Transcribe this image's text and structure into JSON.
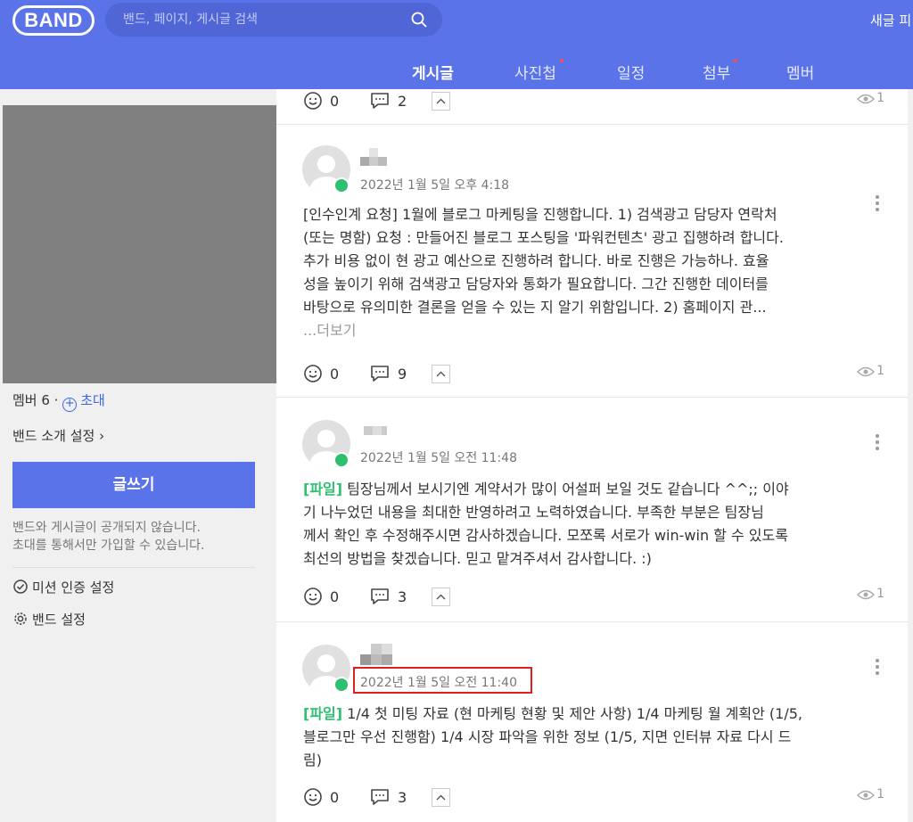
{
  "header": {
    "logo": "BAND",
    "search_placeholder": "밴드, 페이지, 게시글 검색",
    "right_text": "새글 피"
  },
  "tabs": [
    {
      "label": "게시글",
      "active": true,
      "dot": false
    },
    {
      "label": "사진첩",
      "active": false,
      "dot": true
    },
    {
      "label": "일정",
      "active": false,
      "dot": false
    },
    {
      "label": "첨부",
      "active": false,
      "dot": true
    },
    {
      "label": "멤버",
      "active": false,
      "dot": false
    }
  ],
  "sidebar": {
    "member_count": "멤버 6 ·",
    "invite": "초대",
    "band_intro": "밴드 소개 설정",
    "write_button": "글쓰기",
    "notice_line1": "밴드와 게시글이 공개되지 않습니다.",
    "notice_line2": "초대를 통해서만 가입할 수 있습니다.",
    "mission": "미션 인증 설정",
    "band_settings": "밴드 설정"
  },
  "posts": [
    {
      "comments": "0",
      "emotions": "2",
      "views": "1"
    },
    {
      "date": "2022년 1월 5일 오후 4:18",
      "line1": "[인수인계 요청] 1월에 블로그 마케팅을 진행합니다. 1) 검색광고 담당자 연락처",
      "line2": "(또는 명함) 요청 : 만들어진 블로그 포스팅을 '파워컨텐츠' 광고 집행하려 합니다.",
      "line3": "추가 비용 없이 현 광고 예산으로 진행하려 합니다. 바로 진행은 가능하나. 효율",
      "line4": "성을 높이기 위해 검색광고 담당자와 통화가 필요합니다. 그간 진행한 데이터를",
      "line5": "바탕으로 유의미한 결론을 얻을 수 있는 지 알기 위함입니다.  2) 홈페이지 관...",
      "more": "...더보기",
      "comments": "0",
      "emotions": "9",
      "views": "1"
    },
    {
      "date": "2022년 1월 5일 오전 11:48",
      "tag": "[파일]",
      "line1": " 팀장님께서 보시기엔 계약서가 많이 어설퍼 보일 것도 같습니다 ^^;; 이야",
      "line2": "기 나누었던 내용을 최대한 반영하려고 노력하였습니다. 부족한 부분은 팀장님",
      "line3": "께서 확인 후 수정해주시면 감사하겠습니다. 모쪼록 서로가 win-win 할 수 있도록",
      "line4": "최선의 방법을 찾겠습니다. 믿고 맡겨주셔서 감사합니다. :)",
      "comments": "0",
      "emotions": "3",
      "views": "1"
    },
    {
      "date": "2022년 1월 5일 오전 11:40",
      "tag": "[파일]",
      "line1": " 1/4 첫 미팅 자료 (현 마케팅 현황 및 제안 사항) 1/4 마케팅 월 계획안 (1/5,",
      "line2": "블로그만 우선 진행함) 1/4 시장 파악을 위한 정보 (1/5, 지면 인터뷰 자료 다시 드",
      "line3": "림)",
      "comments": "0",
      "emotions": "3",
      "views": "1"
    }
  ],
  "colors": {
    "brand": "#5b73e8",
    "file_tag": "#2fbf71",
    "highlight": "#e02020"
  }
}
